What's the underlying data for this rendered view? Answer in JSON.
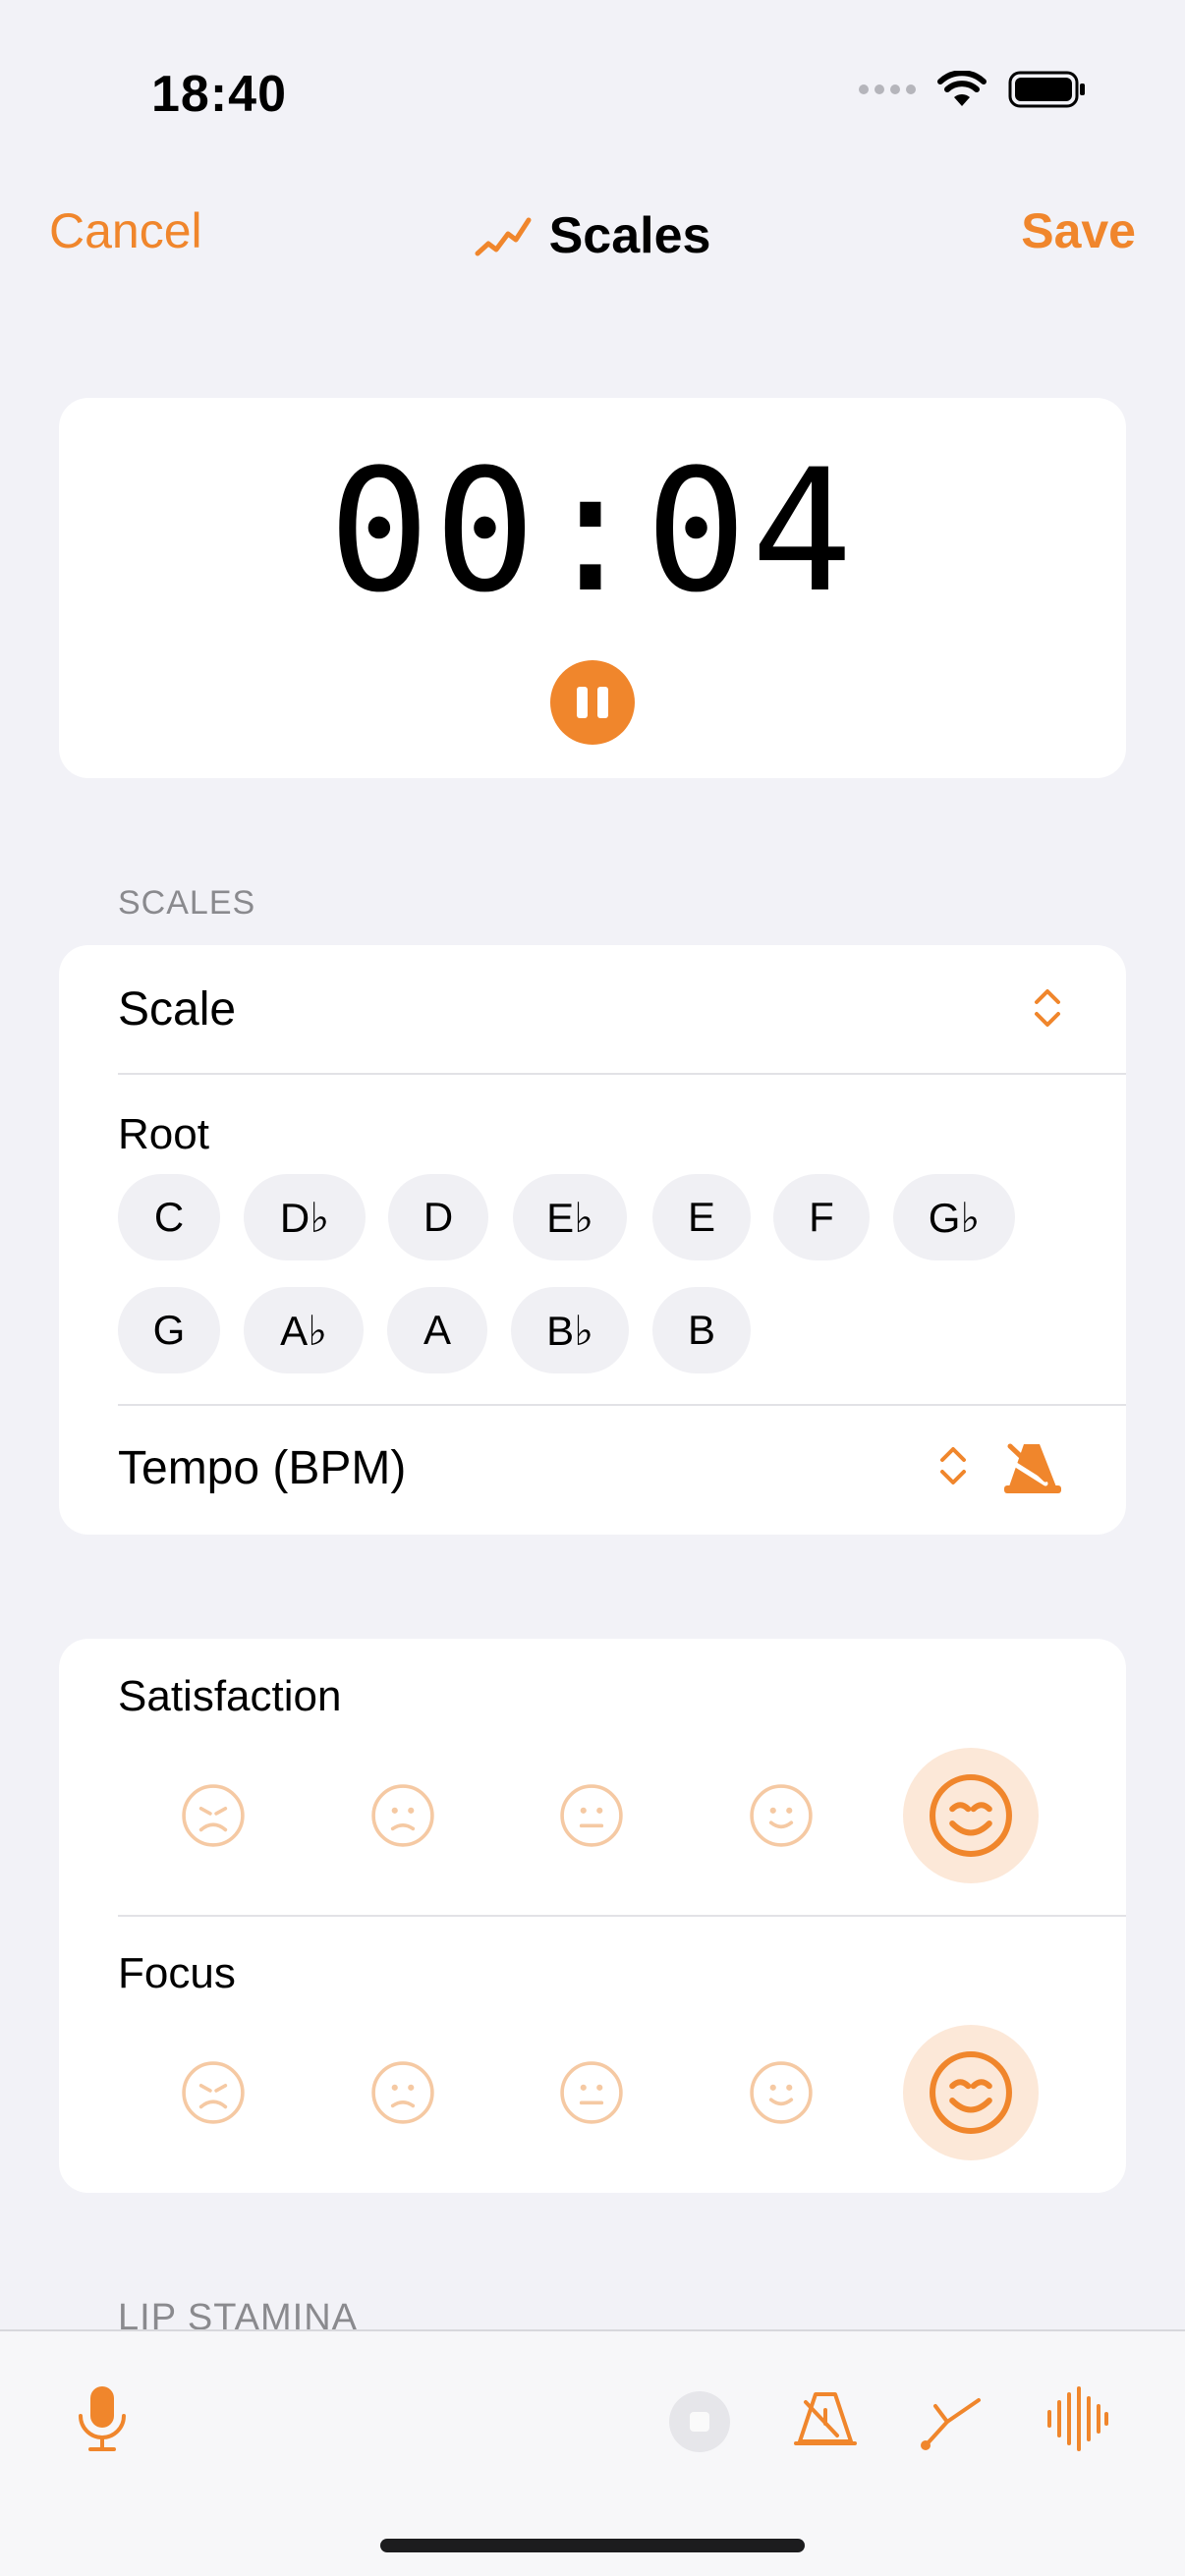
{
  "status_bar": {
    "time": "18:40"
  },
  "nav": {
    "cancel_label": "Cancel",
    "title": "Scales",
    "save_label": "Save",
    "title_icon": "chart-line-icon"
  },
  "timer": {
    "display": "00:04",
    "state": "running"
  },
  "scales_section": {
    "header": "SCALES",
    "scale_label": "Scale",
    "root_label": "Root",
    "roots_row1": [
      "C",
      "D♭",
      "D",
      "E♭",
      "E",
      "F",
      "G♭"
    ],
    "roots_row2": [
      "G",
      "A♭",
      "A",
      "B♭",
      "B"
    ],
    "tempo_label": "Tempo (BPM)"
  },
  "mood_section": {
    "satisfaction_label": "Satisfaction",
    "focus_label": "Focus",
    "scale_levels": 5,
    "satisfaction_selected": 5,
    "focus_selected": 5
  },
  "next_section_header": "LIP STAMINA",
  "toolbar": {
    "icons": [
      "microphone-icon",
      "record-stop-icon",
      "metronome-icon",
      "tuning-fork-icon",
      "waveform-icon"
    ]
  },
  "colors": {
    "accent": "#f0862c",
    "background": "#f2f2f7",
    "card": "#ffffff",
    "chip": "#f0f0f4"
  }
}
